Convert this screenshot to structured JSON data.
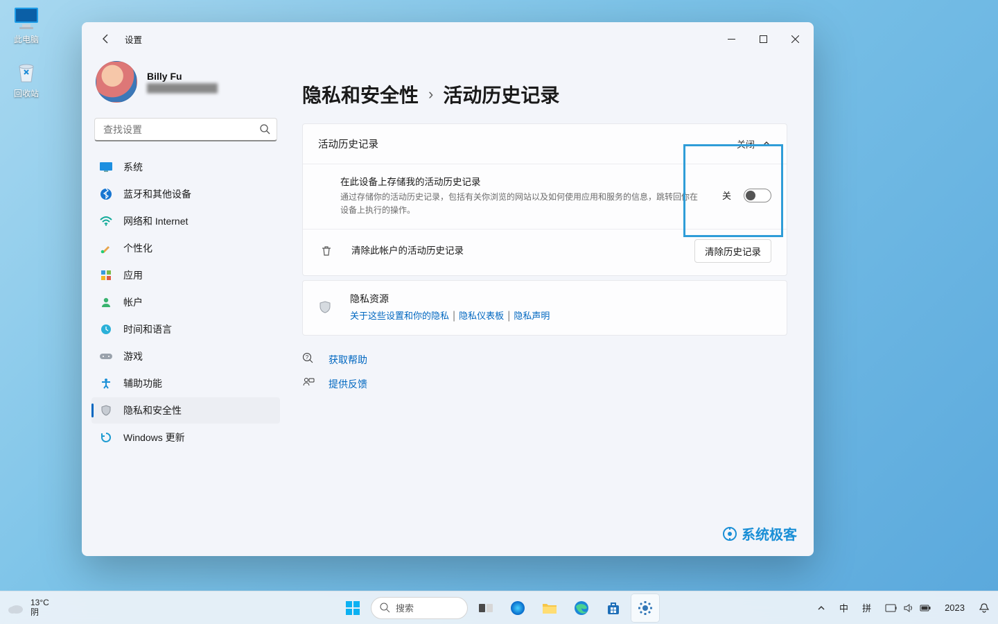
{
  "desktop": {
    "this_pc": "此电脑",
    "recycle_bin": "回收站"
  },
  "window": {
    "title": "设置",
    "user": {
      "name": "Billy Fu",
      "email": "████████████"
    },
    "search_placeholder": "查找设置",
    "nav": {
      "system": "系统",
      "bluetooth": "蓝牙和其他设备",
      "network": "网络和 Internet",
      "personalization": "个性化",
      "apps": "应用",
      "accounts": "帐户",
      "time": "时间和语言",
      "gaming": "游戏",
      "accessibility": "辅助功能",
      "privacy": "隐私和安全性",
      "update": "Windows 更新"
    },
    "breadcrumb": {
      "root": "隐私和安全性",
      "page": "活动历史记录"
    },
    "activity": {
      "card_title": "活动历史记录",
      "card_state": "关闭",
      "store_title": "在此设备上存储我的活动历史记录",
      "store_desc": "通过存储你的活动历史记录，包括有关你浏览的网站以及如何使用应用和服务的信息，跳转回你在设备上执行的操作。",
      "toggle_label": "关",
      "clear_title": "清除此帐户的活动历史记录",
      "clear_button": "清除历史记录"
    },
    "resources": {
      "title": "隐私资源",
      "link1": "关于这些设置和你的隐私",
      "link2": "隐私仪表板",
      "link3": "隐私声明"
    },
    "help": {
      "get_help": "获取帮助",
      "feedback": "提供反馈"
    },
    "watermark": "系统极客"
  },
  "taskbar": {
    "weather_temp": "13°C",
    "weather_cond": "阴",
    "search_placeholder": "搜索",
    "ime1": "中",
    "ime2": "拼",
    "year": "2023"
  }
}
